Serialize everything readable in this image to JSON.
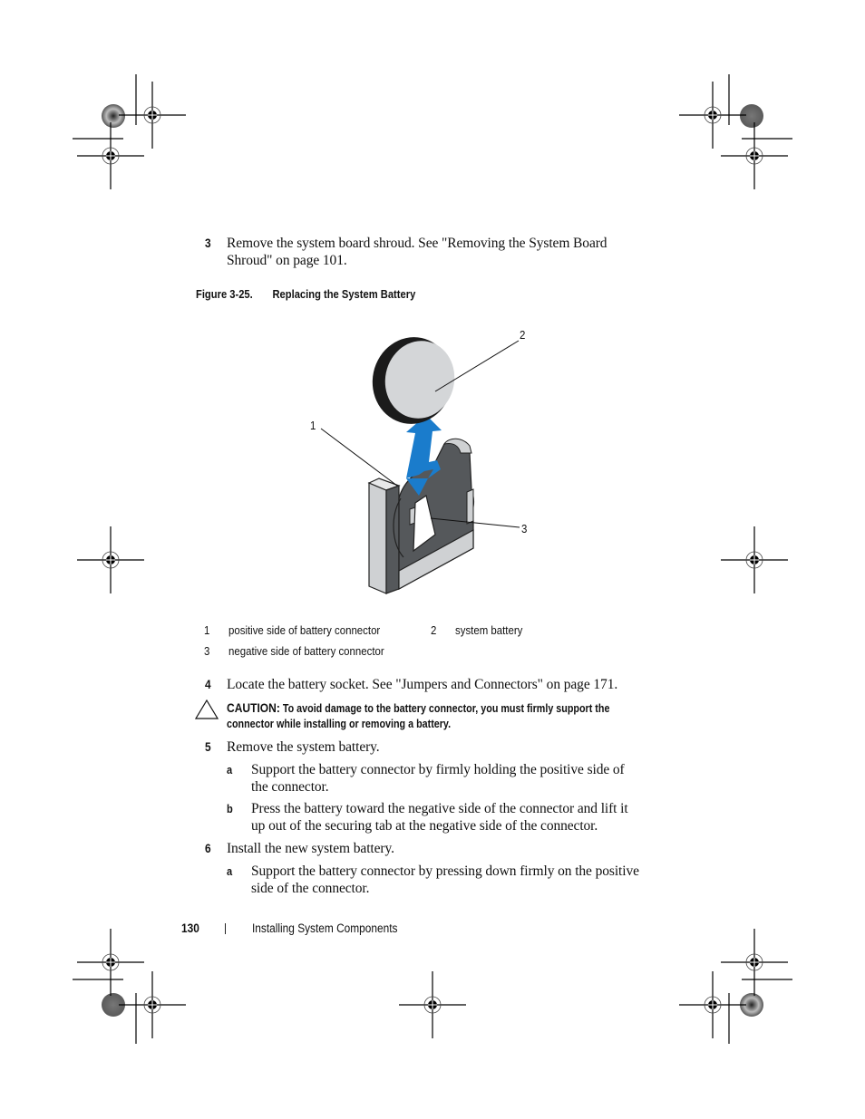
{
  "page": {
    "number": "130",
    "section_title": "Installing System Components"
  },
  "steps": [
    {
      "num": "3",
      "lines": [
        "Remove the system board shroud. See \"Removing the System Board",
        "Shroud\" on page 101."
      ]
    },
    {
      "num": "4",
      "lines": [
        "Locate the battery socket. See \"Jumpers and Connectors\" on page 171."
      ]
    },
    {
      "num": "5",
      "lines": [
        "Remove the system battery."
      ],
      "substeps": [
        {
          "letter": "a",
          "lines": [
            "Support the battery connector by firmly holding the positive side of",
            "the connector."
          ]
        },
        {
          "letter": "b",
          "lines": [
            "Press the battery toward the negative side of the connector and lift it",
            "up out of the securing tab at the negative side of the connector."
          ]
        }
      ]
    },
    {
      "num": "6",
      "lines": [
        "Install the new system battery."
      ],
      "substeps": [
        {
          "letter": "a",
          "lines": [
            "Support the battery connector by pressing down firmly on the positive",
            "side of the connector."
          ]
        }
      ]
    }
  ],
  "figure": {
    "caption_label": "Figure 3-25.",
    "caption_title": "Replacing the System Battery",
    "callouts": [
      "1",
      "2",
      "3"
    ],
    "colors": {
      "arrow": "#1a7ccc",
      "battery_face": "#d4d6d8",
      "battery_edge": "#1b1b1b",
      "connector_dark": "#55585b",
      "connector_light": "#cfd1d3"
    },
    "legend": [
      {
        "num": "1",
        "text": "positive side of battery connector"
      },
      {
        "num": "2",
        "text": "system battery"
      },
      {
        "num": "3",
        "text": "negative side of battery connector"
      }
    ]
  },
  "caution": {
    "label": "CAUTION:",
    "lines": [
      "To avoid damage to the battery connector, you must firmly support the",
      "connector while installing or removing a battery."
    ]
  }
}
